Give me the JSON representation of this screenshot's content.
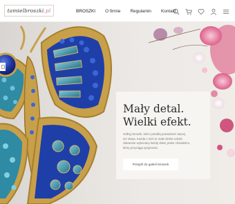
{
  "header": {
    "logo": {
      "main": "tamielbroszki",
      "suffix": ".pl"
    },
    "nav": [
      {
        "label": "BROSZKI",
        "active": true
      },
      {
        "label": "O firmie",
        "active": false
      },
      {
        "label": "Regulamin",
        "active": false
      },
      {
        "label": "Kontakt",
        "active": false
      }
    ],
    "icons": [
      "search-icon",
      "cart-icon",
      "heart-icon",
      "user-icon",
      "menu-icon"
    ]
  },
  "hero": {
    "headline_line1": "Mały detal.",
    "headline_line2": "Wielki efekt.",
    "description": [
      "Odkryj broszki, które potrafią powiedzieć więcej",
      "niż słowa. Każda z nich to małe dzieło sztuki!",
      "Starannie wykonany każdy detal, pełne charakteru,",
      "który przyciąga spojrzenia."
    ],
    "cta_label": "Przejdź do galerii broszek"
  },
  "colors": {
    "accent_pink": "#c9788e",
    "gold": "#c99b3e",
    "sapphire": "#1f3fa8",
    "teal": "#3a8a9c"
  }
}
